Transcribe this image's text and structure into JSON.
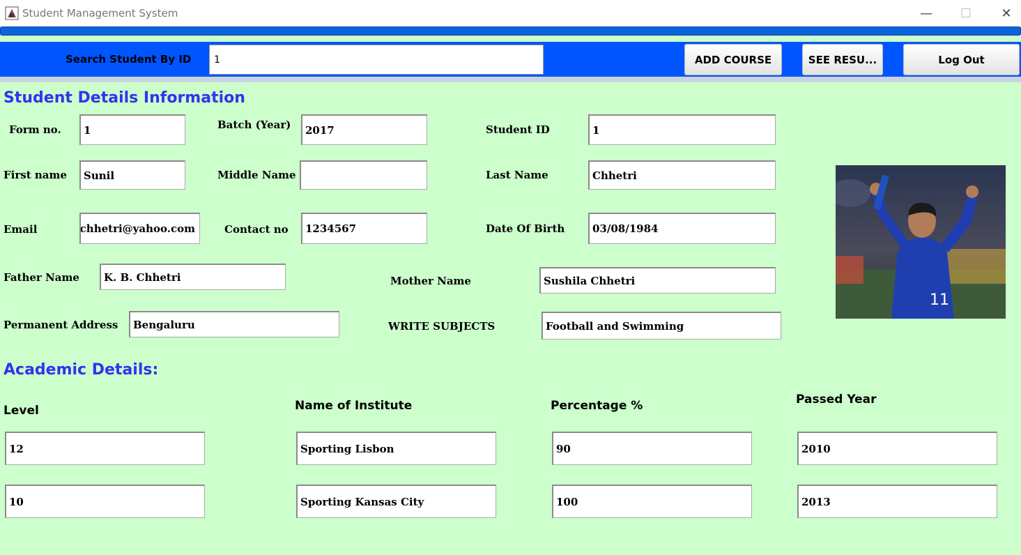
{
  "window": {
    "title": "Student Management System",
    "minimize_icon": "minimize-icon",
    "maximize_icon": "maximize-icon",
    "close_icon": "close-icon",
    "minimize_glyph": "—",
    "maximize_glyph": "☐",
    "close_glyph": "✕"
  },
  "progress": {
    "value_percent": 100,
    "color": "#0a64e0"
  },
  "toolbar": {
    "search_label": "Search Student By ID",
    "search_value": "1",
    "add_course_label": "ADD COURSE",
    "see_result_label": "SEE RESU...",
    "logout_label": "Log Out",
    "bar_color": "#0055ff"
  },
  "student": {
    "heading": "Student Details Information",
    "form_no_label": "Form no.",
    "form_no": "1",
    "batch_label": "Batch (Year)",
    "batch": "2017",
    "student_id_label": "Student ID",
    "student_id": "1",
    "first_name_label": "First name",
    "first_name": "Sunil",
    "middle_name_label": "Middle Name",
    "middle_name": "",
    "last_name_label": "Last Name",
    "last_name": "Chhetri",
    "email_label": "Email",
    "email": "nilchhetri@yahoo.com",
    "contact_label": "Contact no",
    "contact": "1234567",
    "dob_label": "Date Of Birth",
    "dob": "03/08/1984",
    "father_label": "Father Name",
    "father": "K. B. Chhetri",
    "mother_label": "Mother Name",
    "mother": "Sushila Chhetri",
    "address_label": "Permanent Address",
    "address": "Bengaluru",
    "subjects_label": "WRITE SUBJECTS",
    "subjects": "Football and Swimming",
    "photo": "student-photo"
  },
  "academic": {
    "heading": "Academic Details:",
    "columns": [
      "Level",
      "Name of Institute",
      "Percentage %",
      "Passed Year"
    ],
    "rows": [
      [
        "12",
        "Sporting Lisbon",
        "90",
        "2010"
      ],
      [
        "10",
        "Sporting Kansas City",
        "100",
        "2013"
      ]
    ]
  },
  "colors": {
    "background": "#ccffcc",
    "heading": "#3333ee"
  }
}
